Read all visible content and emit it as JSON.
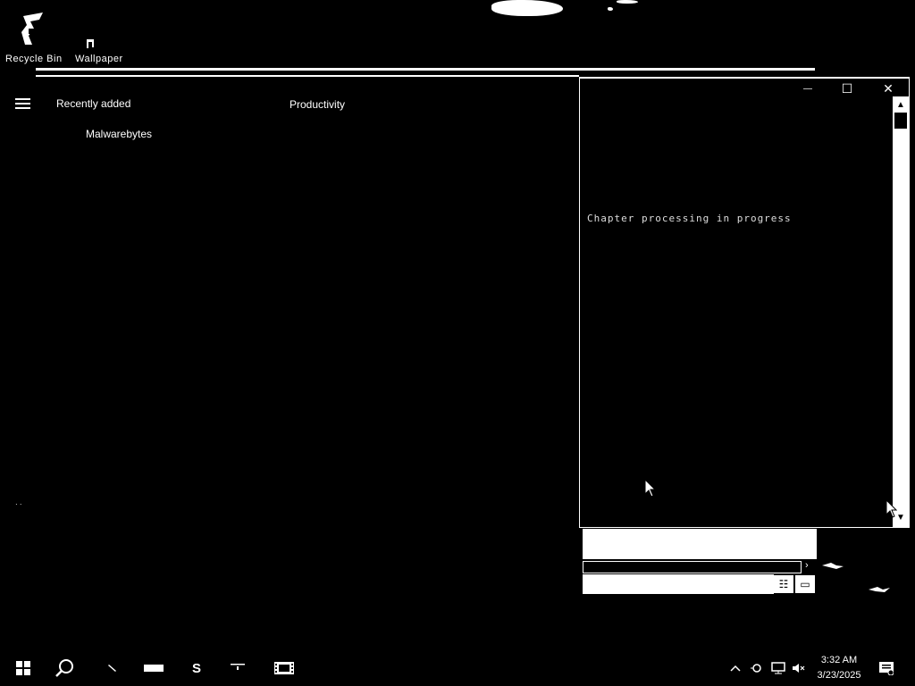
{
  "desktop": {
    "icons": [
      {
        "label": "Recycle Bin"
      },
      {
        "label": "Wallpaper"
      }
    ]
  },
  "start_menu": {
    "recently_added_label": "Recently added",
    "apps": [
      {
        "label": "Malwarebytes"
      }
    ],
    "group_label": "Productivity",
    "footer_dots": "· ·"
  },
  "window": {
    "minimize_symbol": "—",
    "maximize_symbol": "☐",
    "close_symbol": "✕",
    "status_text": "Chapter processing in progress"
  },
  "taskbar": {
    "search_letter": "S",
    "clock_time": "3:32 AM",
    "clock_date": "3/23/2025",
    "icons": [
      "windows-start-icon",
      "search-icon",
      "pen-icon",
      "taskview-icon",
      "s-app-icon",
      "tool-icon",
      "film-icon"
    ]
  },
  "colors": {
    "background": "#000000",
    "foreground": "#ffffff"
  }
}
